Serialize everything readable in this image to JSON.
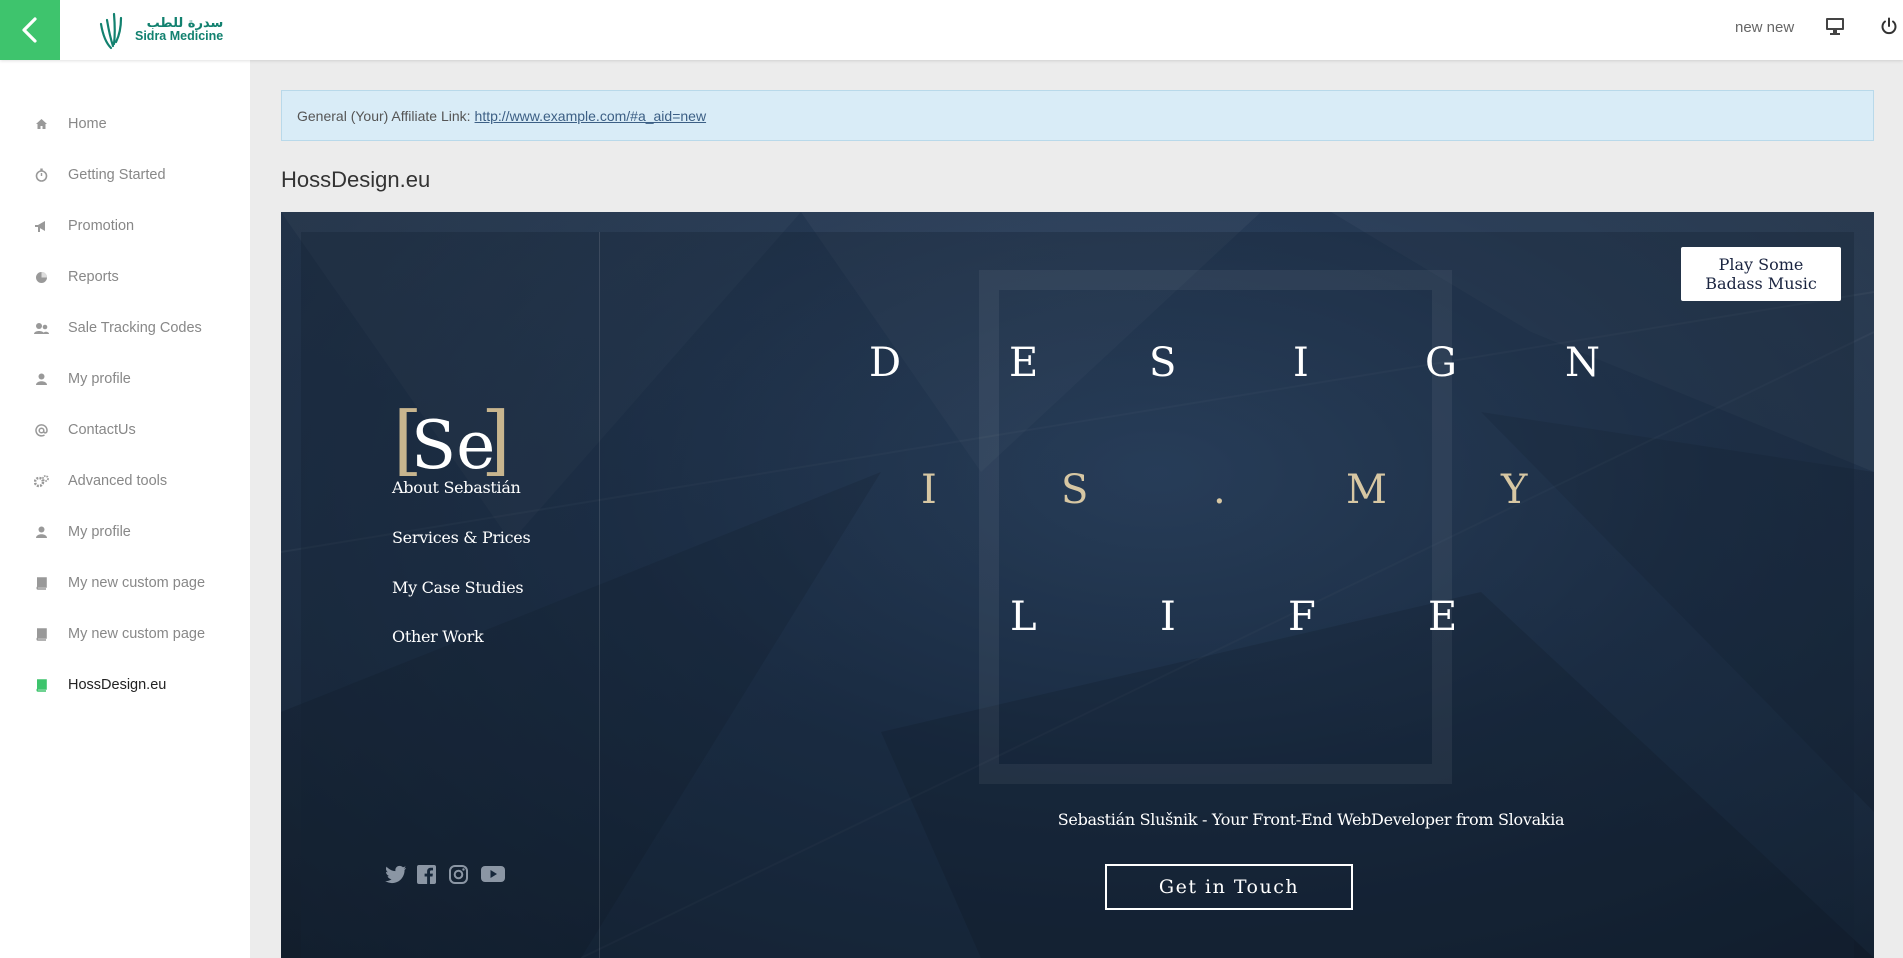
{
  "app": {
    "logo_ar": "سدرة للطب",
    "logo_en": "Sidra Medicine",
    "user_name": "new new",
    "accent_color": "#3ec46d"
  },
  "sidebar": {
    "items": [
      {
        "label": "Home",
        "icon": "home-icon",
        "active": false
      },
      {
        "label": "Getting Started",
        "icon": "stopwatch-icon",
        "active": false
      },
      {
        "label": "Promotion",
        "icon": "megaphone-icon",
        "active": false
      },
      {
        "label": "Reports",
        "icon": "pie-chart-icon",
        "active": false
      },
      {
        "label": "Sale Tracking Codes",
        "icon": "users-icon",
        "active": false
      },
      {
        "label": "My profile",
        "icon": "user-icon",
        "active": false
      },
      {
        "label": "ContactUs",
        "icon": "at-icon",
        "active": false
      },
      {
        "label": "Advanced tools",
        "icon": "cogs-icon",
        "active": false
      },
      {
        "label": "My profile",
        "icon": "user-icon",
        "active": false
      },
      {
        "label": "My new custom page",
        "icon": "book-icon",
        "active": false
      },
      {
        "label": "My new custom page",
        "icon": "book-icon",
        "active": false
      },
      {
        "label": "HossDesign.eu",
        "icon": "book-icon",
        "active": true
      }
    ]
  },
  "main": {
    "affiliate_prefix": "General (Your) Affiliate Link:",
    "affiliate_link": "http://www.example.com/#a_aid=new",
    "page_title": "HossDesign.eu"
  },
  "embed": {
    "logo_left": "[",
    "logo_mid": "Se",
    "logo_right": "]",
    "menu": [
      "About Sebastián",
      "Services & Prices",
      "My Case Studies",
      "Other Work"
    ],
    "headline_row1": [
      "D",
      "E",
      "S",
      "I",
      "G",
      "N"
    ],
    "headline_row2": [
      "I",
      "S",
      ".",
      "M",
      "Y"
    ],
    "headline_row3": [
      "L",
      "I",
      "F",
      "E"
    ],
    "tagline": "Sebastián Slušnik - Your Front-End WebDeveloper from Slovakia",
    "cta_label": "Get in Touch",
    "music_line1": "Play Some",
    "music_line2": "Badass Music",
    "socials": [
      "twitter-icon",
      "facebook-icon",
      "instagram-icon",
      "youtube-icon"
    ]
  }
}
